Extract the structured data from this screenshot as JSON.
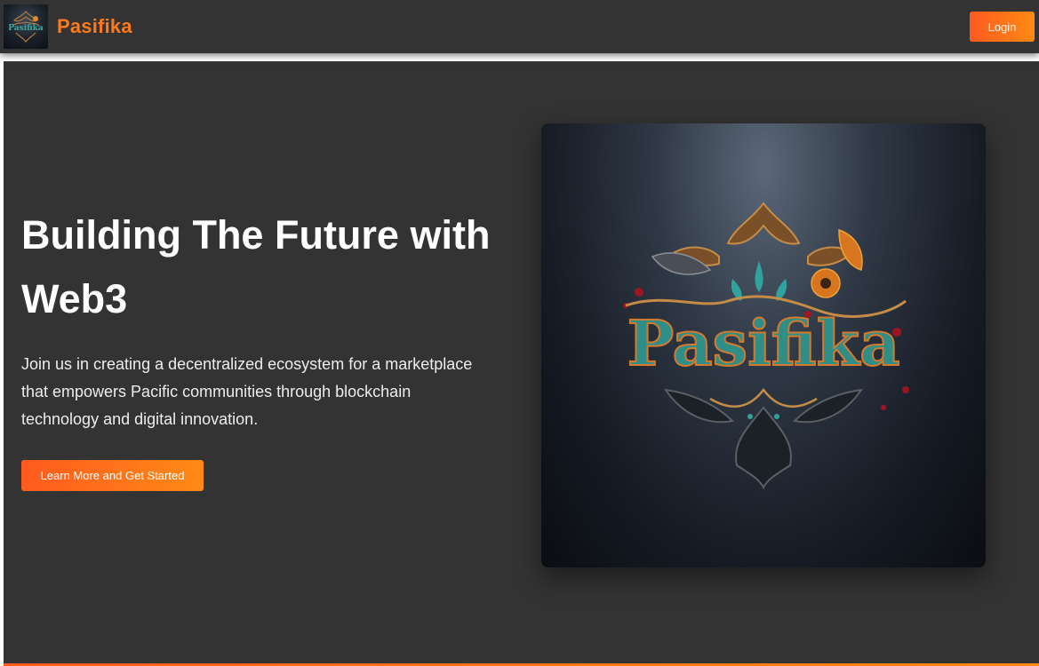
{
  "navbar": {
    "brand": "Pasifika",
    "login_label": "Login",
    "logo_icon": "pasifika-logo-icon"
  },
  "hero": {
    "title": "Building The Future with Web3",
    "description": "Join us in creating a decentralized ecosystem for a marketplace that empowers Pacific communities through blockchain technology and digital innovation.",
    "cta_label": "Learn More and Get Started",
    "image_logo_text": "Pasifika"
  },
  "colors": {
    "accent_start": "#ff5a1f",
    "accent_end": "#ff8a14",
    "brand_text": "#ff7a1a",
    "background": "#333333"
  }
}
